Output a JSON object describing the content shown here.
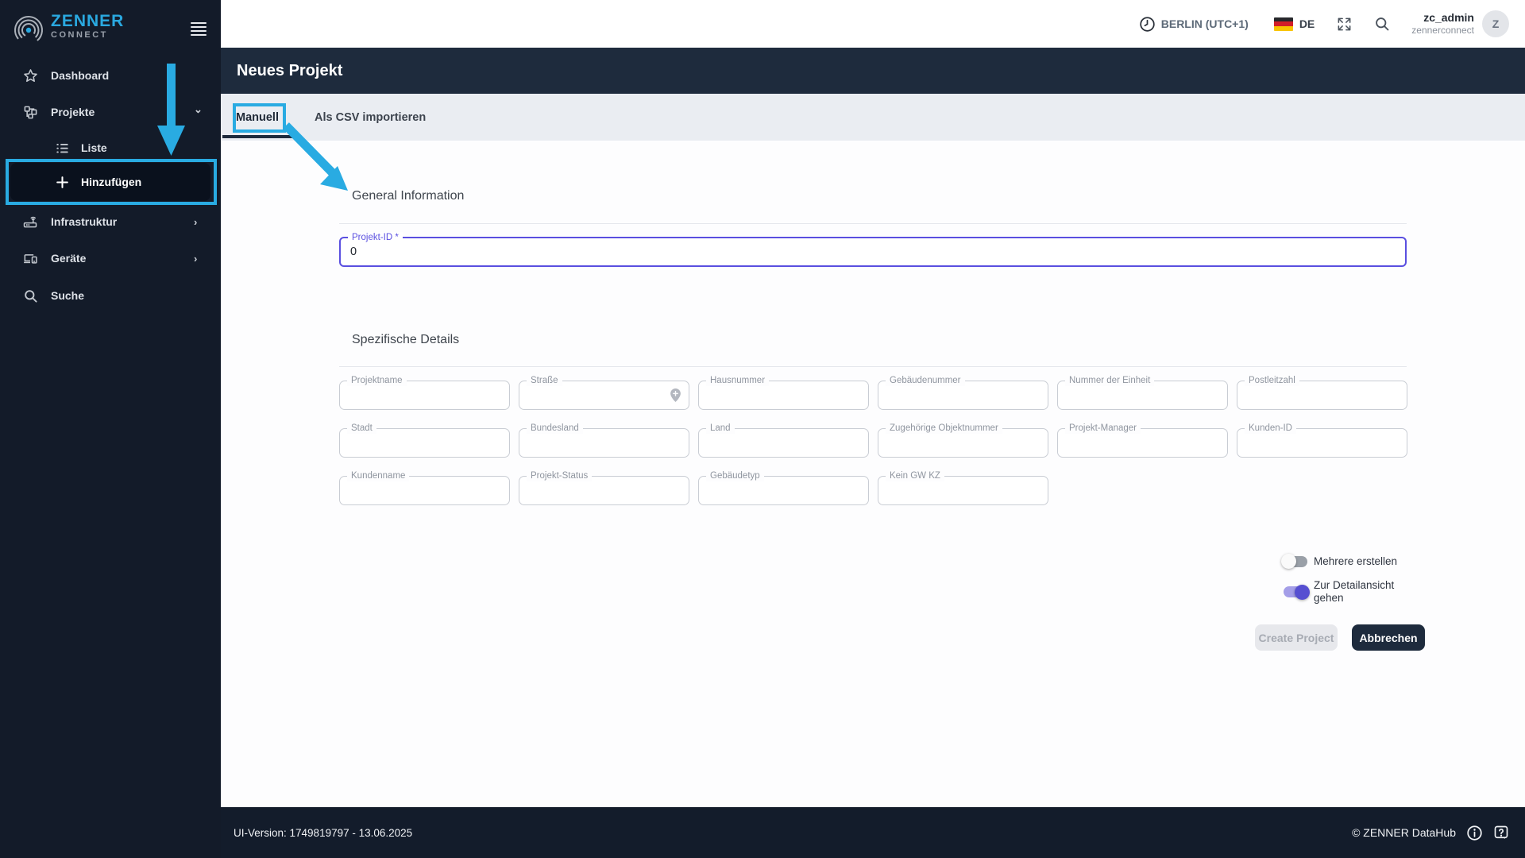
{
  "colors": {
    "annotation": "#29abe2",
    "accent_indigo": "#5a4fe0",
    "brand_blue": "#2aa9e0",
    "dark_navy": "#1e2b3d"
  },
  "sidebar": {
    "brand": "ZENNER",
    "brand_sub": "CONNECT",
    "items": [
      {
        "label": "Dashboard",
        "icon": "star"
      },
      {
        "label": "Projekte",
        "icon": "sitemap",
        "chevron": "down"
      },
      {
        "label": "Liste",
        "icon": "list",
        "sub": true
      },
      {
        "label": "Hinzufügen",
        "icon": "plus",
        "sub": true,
        "active": true
      },
      {
        "label": "Infrastruktur",
        "icon": "router",
        "chevron": "right"
      },
      {
        "label": "Geräte",
        "icon": "devices",
        "chevron": "right"
      },
      {
        "label": "Suche",
        "icon": "search"
      }
    ],
    "chevron_down": "⌄",
    "chevron_right": "›"
  },
  "header": {
    "timezone": "BERLIN (UTC+1)",
    "language": "DE",
    "user_name": "zc_admin",
    "user_org": "zennerconnect",
    "avatar_initial": "Z"
  },
  "page": {
    "title": "Neues Projekt",
    "tabs": [
      {
        "label": "Manuell",
        "active": true
      },
      {
        "label": "Als CSV importieren",
        "active": false
      }
    ]
  },
  "form": {
    "general_heading": "General Information",
    "project_id_label": "Projekt-ID *",
    "project_id_value": "0",
    "details_heading": "Spezifische Details",
    "fields": [
      {
        "label": "Projektname"
      },
      {
        "label": "Straße",
        "icon": "place"
      },
      {
        "label": "Hausnummer"
      },
      {
        "label": "Gebäudenummer"
      },
      {
        "label": "Nummer der Einheit"
      },
      {
        "label": "Postleitzahl"
      },
      {
        "label": "Stadt"
      },
      {
        "label": "Bundesland"
      },
      {
        "label": "Land"
      },
      {
        "label": "Zugehörige Objektnummer"
      },
      {
        "label": "Projekt-Manager"
      },
      {
        "label": "Kunden-ID"
      },
      {
        "label": "Kundenname"
      },
      {
        "label": "Projekt-Status"
      },
      {
        "label": "Gebäudetyp"
      },
      {
        "label": "Kein GW KZ"
      }
    ]
  },
  "actions": {
    "toggle_multiple": "Mehrere erstellen",
    "toggle_multiple_on": false,
    "toggle_detail": "Zur Detailansicht gehen",
    "toggle_detail_on": true,
    "create": "Create Project",
    "cancel": "Abbrechen"
  },
  "footer": {
    "version": "UI-Version: 1749819797 - 13.06.2025",
    "copyright": "© ZENNER DataHub"
  }
}
